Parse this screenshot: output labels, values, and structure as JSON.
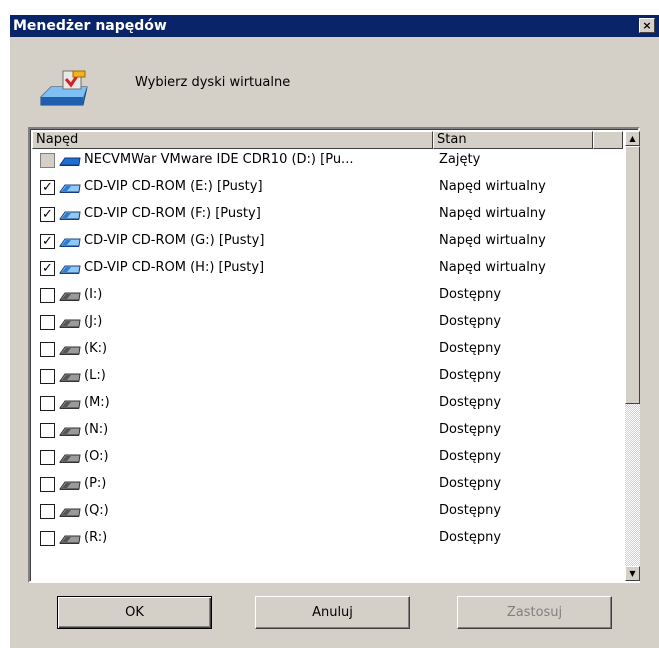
{
  "window": {
    "title": "Menedżer napędów",
    "close_glyph": "×"
  },
  "header": {
    "icon": "virtual-drive-icon",
    "text": "Wybierz dyski wirtualne"
  },
  "list": {
    "columns": [
      "Napęd",
      "Stan"
    ],
    "rows": [
      {
        "checked": false,
        "disabled": true,
        "icon": "physical-cd-drive-icon",
        "label": "NECVMWar VMware IDE CDR10 (D:) [Pu...",
        "state": "Zajęty"
      },
      {
        "checked": true,
        "disabled": false,
        "icon": "virtual-cd-drive-icon",
        "label": "CD-VIP CD-ROM (E:) [Pusty]",
        "state": "Napęd wirtualny"
      },
      {
        "checked": true,
        "disabled": false,
        "icon": "virtual-cd-drive-icon",
        "label": "CD-VIP CD-ROM (F:) [Pusty]",
        "state": "Napęd wirtualny"
      },
      {
        "checked": true,
        "disabled": false,
        "icon": "virtual-cd-drive-icon",
        "label": "CD-VIP CD-ROM (G:) [Pusty]",
        "state": "Napęd wirtualny"
      },
      {
        "checked": true,
        "disabled": false,
        "icon": "virtual-cd-drive-icon",
        "label": "CD-VIP CD-ROM (H:) [Pusty]",
        "state": "Napęd wirtualny"
      },
      {
        "checked": false,
        "disabled": false,
        "icon": "empty-drive-icon",
        "label": "(I:)",
        "state": "Dostępny"
      },
      {
        "checked": false,
        "disabled": false,
        "icon": "empty-drive-icon",
        "label": "(J:)",
        "state": "Dostępny"
      },
      {
        "checked": false,
        "disabled": false,
        "icon": "empty-drive-icon",
        "label": "(K:)",
        "state": "Dostępny"
      },
      {
        "checked": false,
        "disabled": false,
        "icon": "empty-drive-icon",
        "label": "(L:)",
        "state": "Dostępny"
      },
      {
        "checked": false,
        "disabled": false,
        "icon": "empty-drive-icon",
        "label": "(M:)",
        "state": "Dostępny"
      },
      {
        "checked": false,
        "disabled": false,
        "icon": "empty-drive-icon",
        "label": "(N:)",
        "state": "Dostępny"
      },
      {
        "checked": false,
        "disabled": false,
        "icon": "empty-drive-icon",
        "label": "(O:)",
        "state": "Dostępny"
      },
      {
        "checked": false,
        "disabled": false,
        "icon": "empty-drive-icon",
        "label": "(P:)",
        "state": "Dostępny"
      },
      {
        "checked": false,
        "disabled": false,
        "icon": "empty-drive-icon",
        "label": "(Q:)",
        "state": "Dostępny"
      },
      {
        "checked": false,
        "disabled": false,
        "icon": "empty-drive-icon",
        "label": "(R:)",
        "state": "Dostępny"
      }
    ]
  },
  "buttons": {
    "ok": "OK",
    "cancel": "Anuluj",
    "apply": "Zastosuj"
  },
  "colors": {
    "titlebar": "#0a246a",
    "face": "#d4d0c8",
    "virtual_drive": "#2a7fd4",
    "empty_drive": "#555555"
  }
}
